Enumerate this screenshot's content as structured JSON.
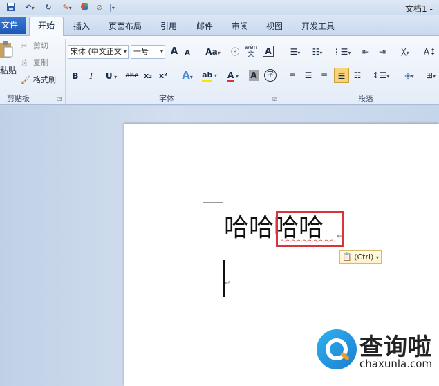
{
  "window": {
    "title": "文档1 - "
  },
  "quick_access": {
    "icons": [
      "save-icon",
      "undo-icon",
      "redo-icon",
      "format-painter-icon",
      "color-circle-icon",
      "clear-icon",
      "customize-icon"
    ]
  },
  "tabs": [
    {
      "label": "文件"
    },
    {
      "label": "开始"
    },
    {
      "label": "插入"
    },
    {
      "label": "页面布局"
    },
    {
      "label": "引用"
    },
    {
      "label": "邮件"
    },
    {
      "label": "审阅"
    },
    {
      "label": "视图"
    },
    {
      "label": "开发工具"
    }
  ],
  "clipboard": {
    "paste_label": "粘贴",
    "cut_label": "剪切",
    "copy_label": "复制",
    "format_painter_label": "格式刷",
    "group_label": "剪贴板"
  },
  "font": {
    "font_name": "宋体 (中文正文",
    "font_size": "一号",
    "grow_label": "A",
    "shrink_label": "A",
    "case_label": "Aa",
    "phonetic_label": "wén",
    "char_border_label": "A",
    "bold_label": "B",
    "italic_label": "I",
    "underline_label": "U",
    "strike_label": "abe",
    "subscript_label": "x₂",
    "superscript_label": "x²",
    "effects_label": "A",
    "highlight_label": "ab",
    "font_color_label": "A",
    "shading_label": "A",
    "enclose_label": "字",
    "group_label": "字体",
    "accent_color": "#d9343b",
    "highlight_color": "#f5e800"
  },
  "paragraph": {
    "group_label": "段落"
  },
  "document": {
    "text_plain": "哈哈",
    "text_selected": "哈哈",
    "para_mark": "↵",
    "paste_options_label": "(Ctrl)",
    "highlight_color": "#d9343b"
  },
  "watermark": {
    "name": "查询啦",
    "url": "chaxunla.com"
  }
}
